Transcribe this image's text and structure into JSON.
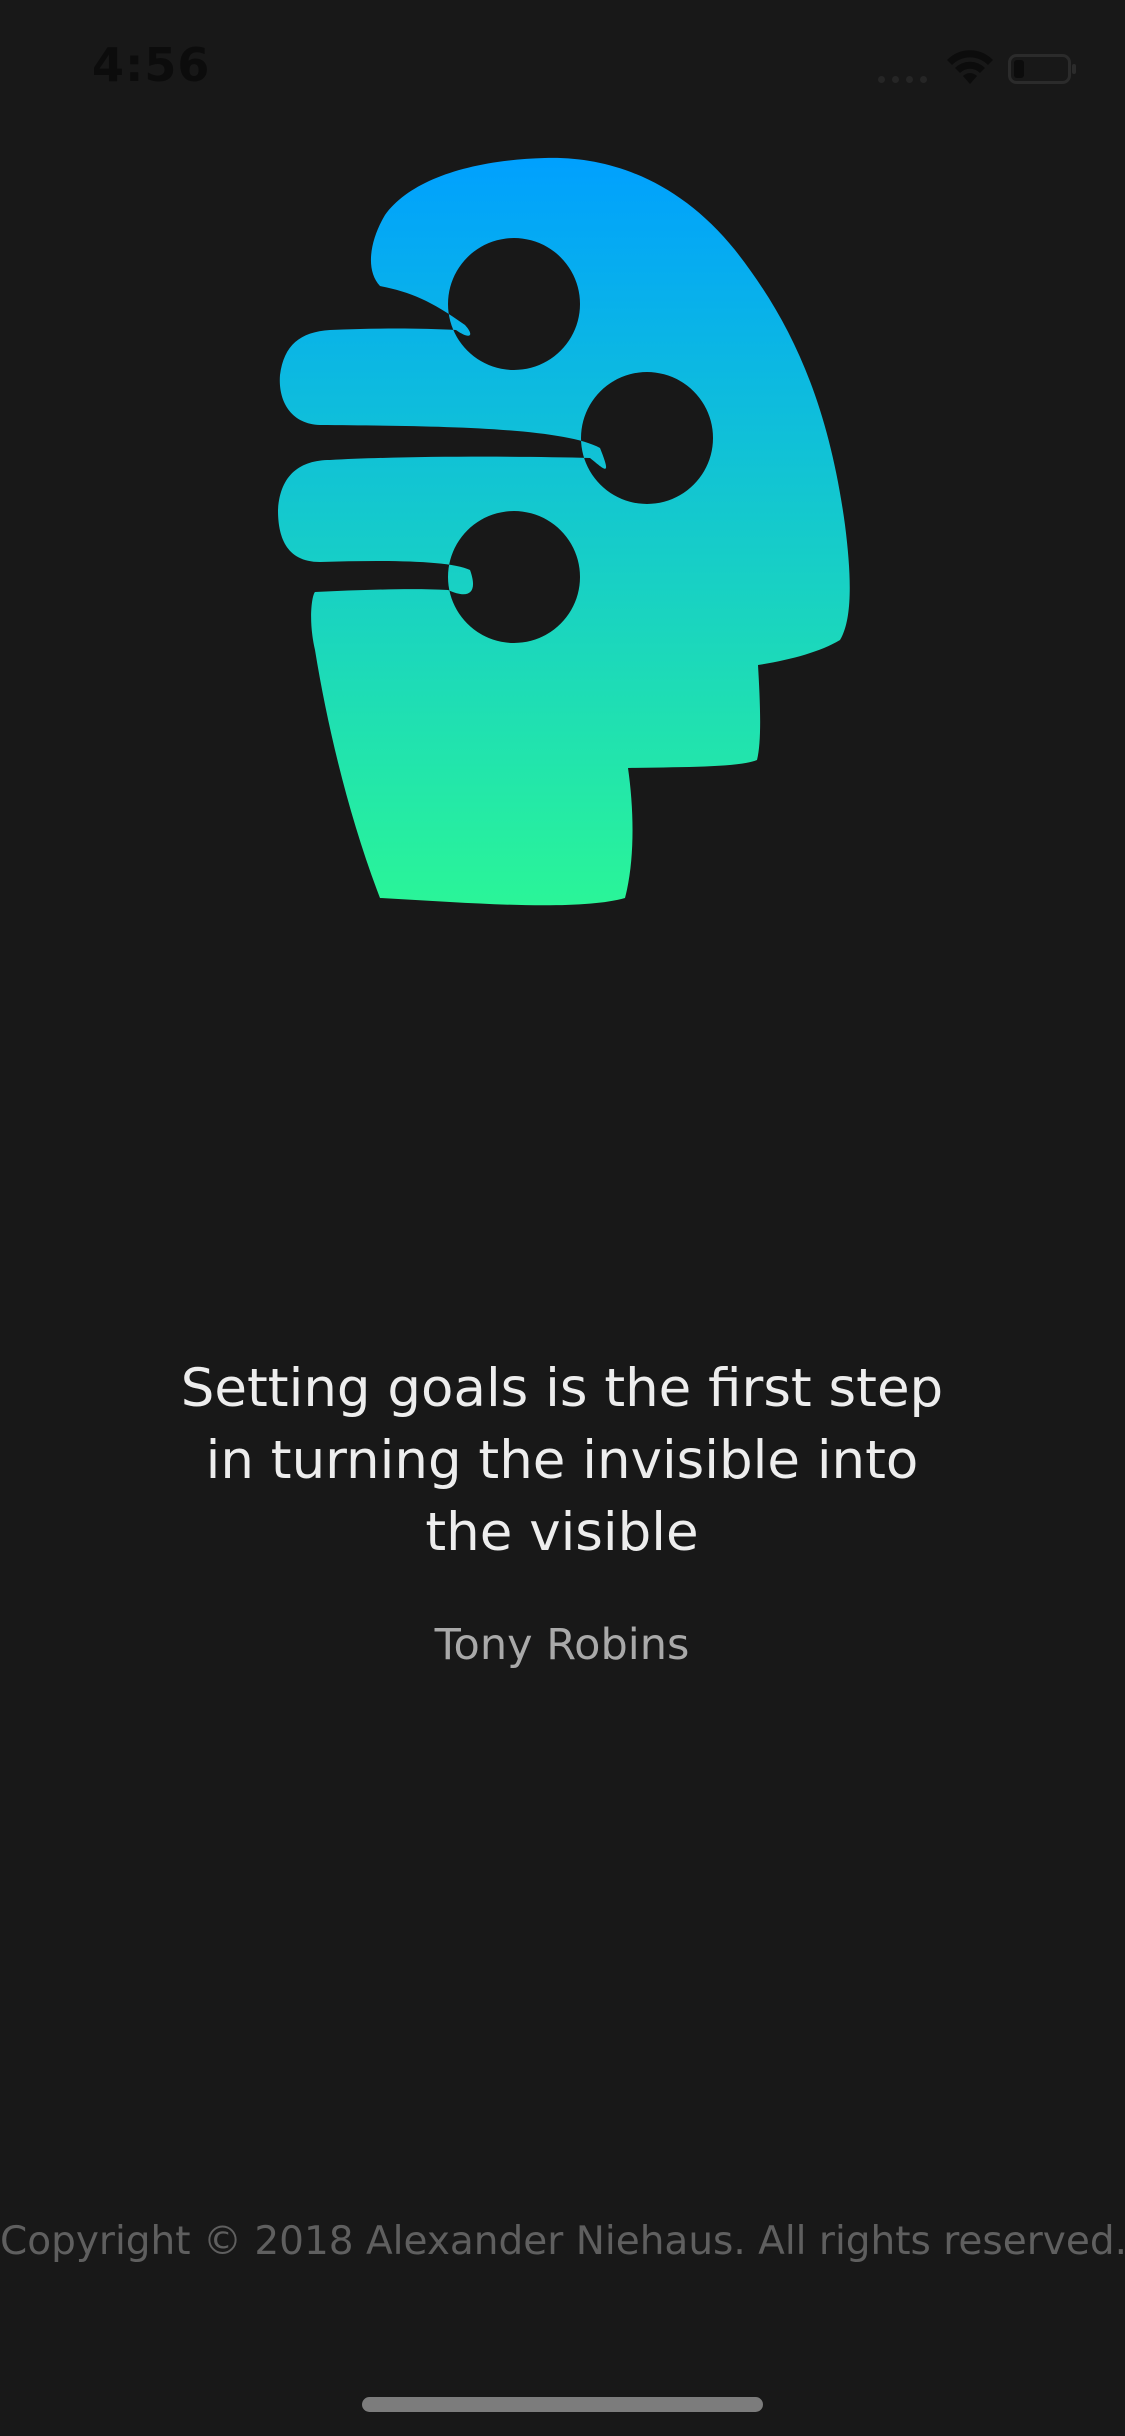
{
  "status_bar": {
    "time": "4:56",
    "signal_icon": "cellular-signal-icon",
    "wifi_icon": "wifi-icon",
    "battery_icon": "battery-icon",
    "battery_level": 0.2
  },
  "logo": {
    "icon": "head-goals-logo-icon",
    "gradient_top": "#00A0FF",
    "gradient_bottom": "#2AF598"
  },
  "quote": {
    "text_line_1": "Setting goals is the first step",
    "text_line_2": "in turning the invisible into",
    "text_line_3": "the visible",
    "author": "Tony Robins"
  },
  "footer": {
    "copyright": "Copyright © 2018 Alexander Niehaus. All rights reserved."
  },
  "colors": {
    "background": "#181818",
    "quote_text": "#EDEDED",
    "author_text": "#A9A9A9",
    "copyright_text": "#5F5F5F"
  }
}
